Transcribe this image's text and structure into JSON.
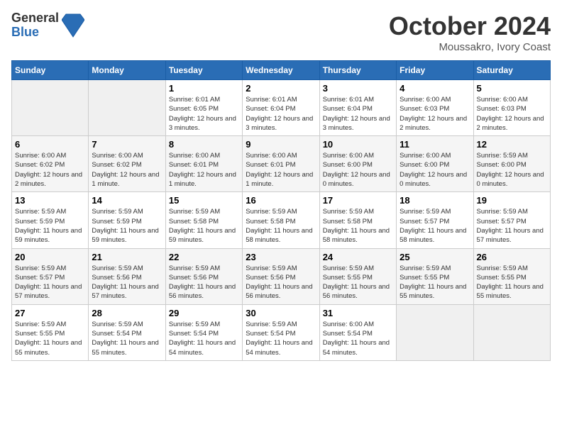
{
  "header": {
    "logo_general": "General",
    "logo_blue": "Blue",
    "month_title": "October 2024",
    "location": "Moussakro, Ivory Coast"
  },
  "days_of_week": [
    "Sunday",
    "Monday",
    "Tuesday",
    "Wednesday",
    "Thursday",
    "Friday",
    "Saturday"
  ],
  "weeks": [
    [
      {
        "day": "",
        "empty": true
      },
      {
        "day": "",
        "empty": true
      },
      {
        "day": "1",
        "sunrise": "6:01 AM",
        "sunset": "6:05 PM",
        "daylight": "12 hours and 3 minutes."
      },
      {
        "day": "2",
        "sunrise": "6:01 AM",
        "sunset": "6:04 PM",
        "daylight": "12 hours and 3 minutes."
      },
      {
        "day": "3",
        "sunrise": "6:01 AM",
        "sunset": "6:04 PM",
        "daylight": "12 hours and 3 minutes."
      },
      {
        "day": "4",
        "sunrise": "6:00 AM",
        "sunset": "6:03 PM",
        "daylight": "12 hours and 2 minutes."
      },
      {
        "day": "5",
        "sunrise": "6:00 AM",
        "sunset": "6:03 PM",
        "daylight": "12 hours and 2 minutes."
      }
    ],
    [
      {
        "day": "6",
        "sunrise": "6:00 AM",
        "sunset": "6:02 PM",
        "daylight": "12 hours and 2 minutes."
      },
      {
        "day": "7",
        "sunrise": "6:00 AM",
        "sunset": "6:02 PM",
        "daylight": "12 hours and 1 minute."
      },
      {
        "day": "8",
        "sunrise": "6:00 AM",
        "sunset": "6:01 PM",
        "daylight": "12 hours and 1 minute."
      },
      {
        "day": "9",
        "sunrise": "6:00 AM",
        "sunset": "6:01 PM",
        "daylight": "12 hours and 1 minute."
      },
      {
        "day": "10",
        "sunrise": "6:00 AM",
        "sunset": "6:00 PM",
        "daylight": "12 hours and 0 minutes."
      },
      {
        "day": "11",
        "sunrise": "6:00 AM",
        "sunset": "6:00 PM",
        "daylight": "12 hours and 0 minutes."
      },
      {
        "day": "12",
        "sunrise": "5:59 AM",
        "sunset": "6:00 PM",
        "daylight": "12 hours and 0 minutes."
      }
    ],
    [
      {
        "day": "13",
        "sunrise": "5:59 AM",
        "sunset": "5:59 PM",
        "daylight": "11 hours and 59 minutes."
      },
      {
        "day": "14",
        "sunrise": "5:59 AM",
        "sunset": "5:59 PM",
        "daylight": "11 hours and 59 minutes."
      },
      {
        "day": "15",
        "sunrise": "5:59 AM",
        "sunset": "5:58 PM",
        "daylight": "11 hours and 59 minutes."
      },
      {
        "day": "16",
        "sunrise": "5:59 AM",
        "sunset": "5:58 PM",
        "daylight": "11 hours and 58 minutes."
      },
      {
        "day": "17",
        "sunrise": "5:59 AM",
        "sunset": "5:58 PM",
        "daylight": "11 hours and 58 minutes."
      },
      {
        "day": "18",
        "sunrise": "5:59 AM",
        "sunset": "5:57 PM",
        "daylight": "11 hours and 58 minutes."
      },
      {
        "day": "19",
        "sunrise": "5:59 AM",
        "sunset": "5:57 PM",
        "daylight": "11 hours and 57 minutes."
      }
    ],
    [
      {
        "day": "20",
        "sunrise": "5:59 AM",
        "sunset": "5:57 PM",
        "daylight": "11 hours and 57 minutes."
      },
      {
        "day": "21",
        "sunrise": "5:59 AM",
        "sunset": "5:56 PM",
        "daylight": "11 hours and 57 minutes."
      },
      {
        "day": "22",
        "sunrise": "5:59 AM",
        "sunset": "5:56 PM",
        "daylight": "11 hours and 56 minutes."
      },
      {
        "day": "23",
        "sunrise": "5:59 AM",
        "sunset": "5:56 PM",
        "daylight": "11 hours and 56 minutes."
      },
      {
        "day": "24",
        "sunrise": "5:59 AM",
        "sunset": "5:55 PM",
        "daylight": "11 hours and 56 minutes."
      },
      {
        "day": "25",
        "sunrise": "5:59 AM",
        "sunset": "5:55 PM",
        "daylight": "11 hours and 55 minutes."
      },
      {
        "day": "26",
        "sunrise": "5:59 AM",
        "sunset": "5:55 PM",
        "daylight": "11 hours and 55 minutes."
      }
    ],
    [
      {
        "day": "27",
        "sunrise": "5:59 AM",
        "sunset": "5:55 PM",
        "daylight": "11 hours and 55 minutes."
      },
      {
        "day": "28",
        "sunrise": "5:59 AM",
        "sunset": "5:54 PM",
        "daylight": "11 hours and 55 minutes."
      },
      {
        "day": "29",
        "sunrise": "5:59 AM",
        "sunset": "5:54 PM",
        "daylight": "11 hours and 54 minutes."
      },
      {
        "day": "30",
        "sunrise": "5:59 AM",
        "sunset": "5:54 PM",
        "daylight": "11 hours and 54 minutes."
      },
      {
        "day": "31",
        "sunrise": "6:00 AM",
        "sunset": "5:54 PM",
        "daylight": "11 hours and 54 minutes."
      },
      {
        "day": "",
        "empty": true
      },
      {
        "day": "",
        "empty": true
      }
    ]
  ]
}
